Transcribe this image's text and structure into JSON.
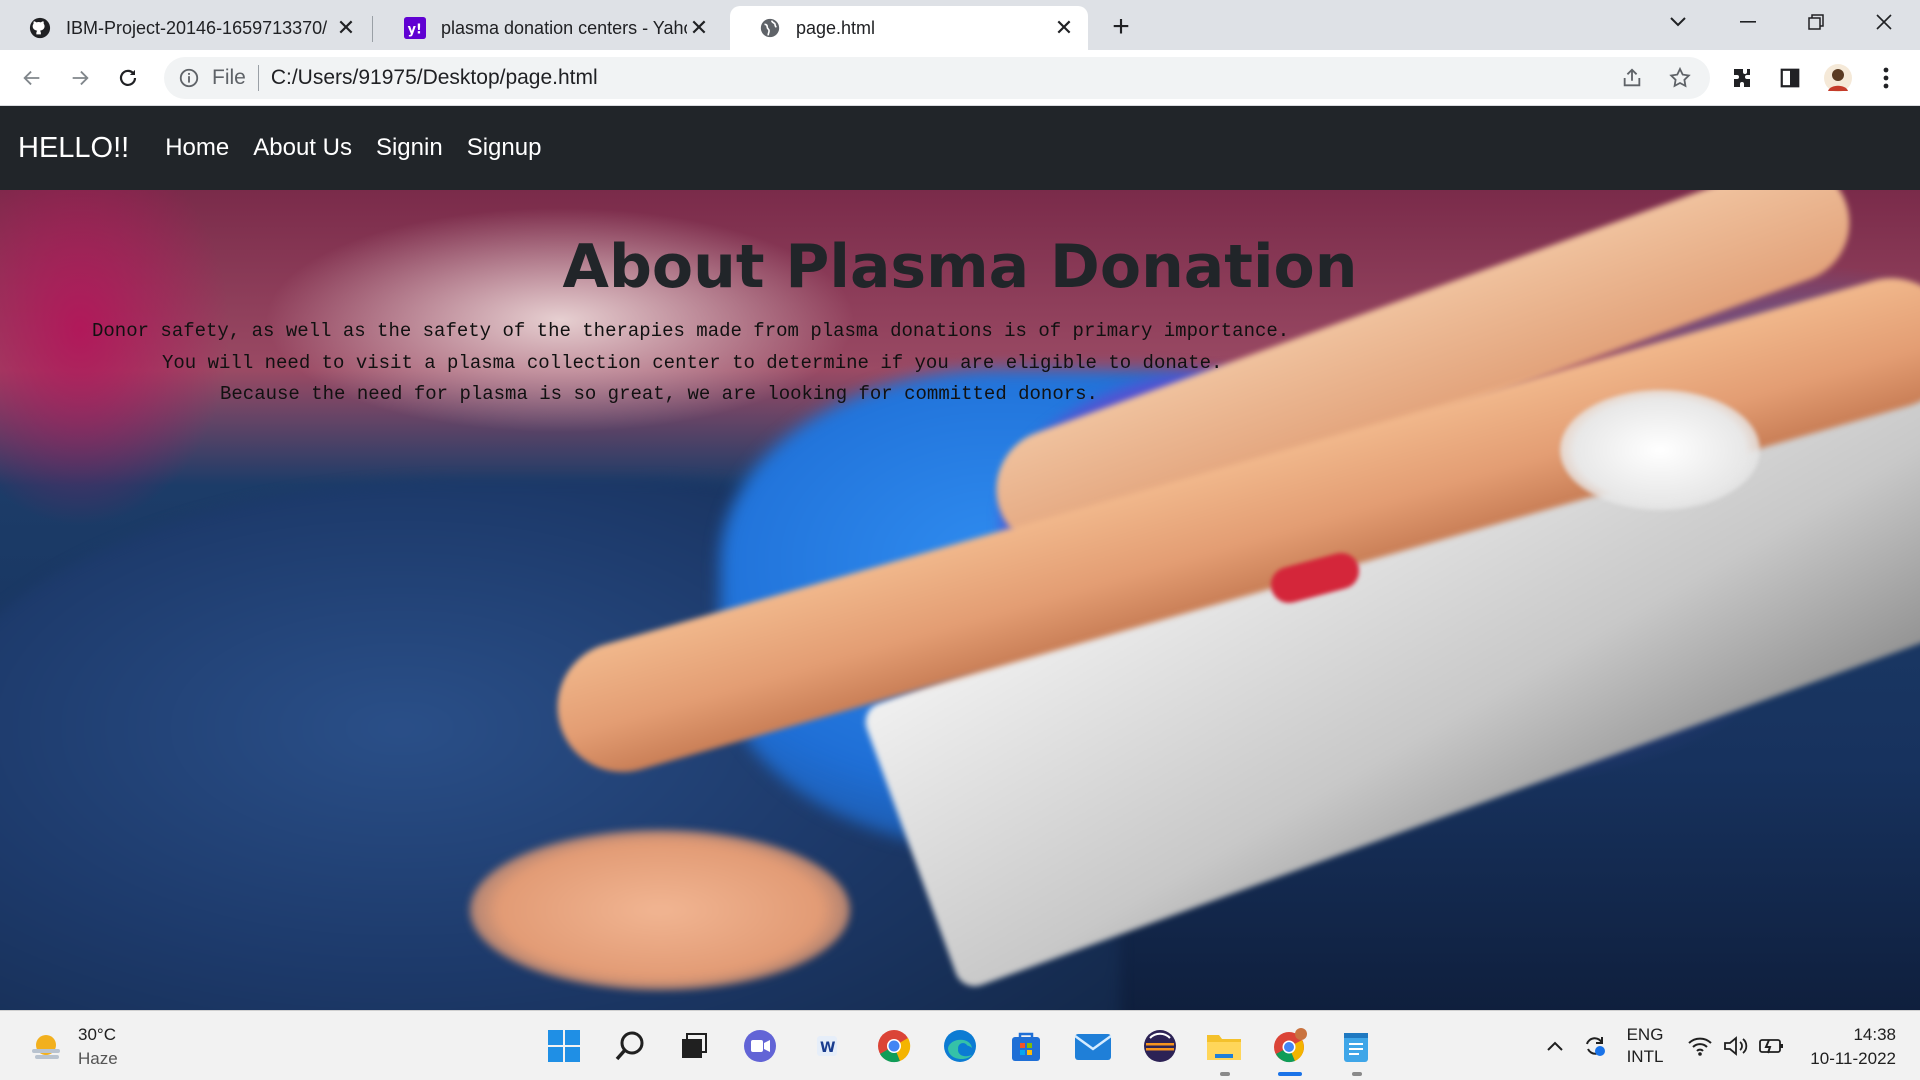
{
  "browser": {
    "tabs": [
      {
        "title": "IBM-Project-20146-1659713370/",
        "icon": "github-icon"
      },
      {
        "title": "plasma donation centers - Yahoo",
        "icon": "yahoo-icon"
      },
      {
        "title": "page.html",
        "icon": "globe-icon",
        "active": true
      }
    ],
    "new_tab_symbol": "+",
    "address": {
      "scheme_label": "File",
      "url": "C:/Users/91975/Desktop/page.html"
    }
  },
  "site": {
    "brand": "HELLO!!",
    "nav": [
      "Home",
      "About Us",
      "Signin",
      "Signup"
    ],
    "hero": {
      "title": "About Plasma Donation",
      "lines": [
        "Donor safety, as well as the safety of the therapies made from plasma donations is of primary importance.",
        "You will need to visit a plasma collection center to determine if you are eligible to donate.",
        "Because the need for plasma is so great, we are looking for committed donors."
      ]
    }
  },
  "taskbar": {
    "weather": {
      "temp": "30°C",
      "condition": "Haze"
    },
    "language": {
      "line1": "ENG",
      "line2": "INTL"
    },
    "clock": {
      "time": "14:38",
      "date": "10-11-2022"
    }
  },
  "colors": {
    "navbar_bg": "#212529",
    "tab_strip_bg": "#dee1e6",
    "accent_blue": "#1a73e8"
  }
}
